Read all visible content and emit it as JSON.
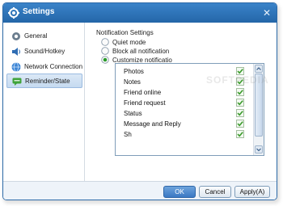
{
  "window": {
    "title": "Settings",
    "close_symbol": "✕"
  },
  "sidebar": {
    "items": [
      {
        "label": "General",
        "icon": "gear-icon",
        "selected": false
      },
      {
        "label": "Sound/Hotkey",
        "icon": "speaker-icon",
        "selected": false
      },
      {
        "label": "Network Connection",
        "icon": "globe-icon",
        "selected": false
      },
      {
        "label": "Reminder/State",
        "icon": "chat-icon",
        "selected": true
      }
    ]
  },
  "notification": {
    "group_label": "Notification Settings",
    "options": [
      {
        "label": "Quiet mode",
        "selected": false
      },
      {
        "label": "Block all notification",
        "selected": false
      },
      {
        "label": "Customize notificatio",
        "selected": true
      }
    ],
    "items": [
      {
        "label": "Photos",
        "checked": true
      },
      {
        "label": "Notes",
        "checked": true
      },
      {
        "label": "Friend online",
        "checked": true
      },
      {
        "label": "Friend request",
        "checked": true
      },
      {
        "label": "Status",
        "checked": true
      },
      {
        "label": "Message and Reply",
        "checked": true
      },
      {
        "label": "Sh",
        "checked": true
      }
    ]
  },
  "watermark": "SOFTPEDIA",
  "buttons": {
    "ok": "OK",
    "cancel": "Cancel",
    "apply": "Apply(A)"
  },
  "colors": {
    "titlebar": "#2d6fb4",
    "accent_button": "#3b78c3",
    "check_green": "#3a9a2a"
  }
}
